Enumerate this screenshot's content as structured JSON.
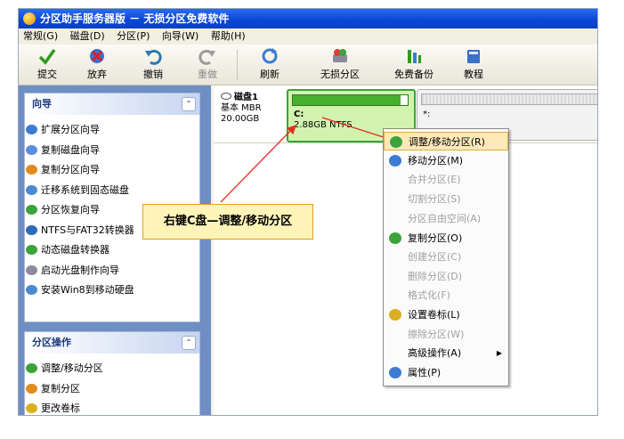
{
  "window": {
    "title": "分区助手服务器版 － 无损分区免费软件"
  },
  "menubar": [
    "常规(G)",
    "磁盘(D)",
    "分区(P)",
    "向导(W)",
    "帮助(H)"
  ],
  "toolbar": {
    "commit": "提交",
    "discard": "放弃",
    "undo": "撤销",
    "redo": "重做",
    "refresh": "刷新",
    "lossless": "无损分区",
    "backup": "免费备份",
    "tutorial": "教程"
  },
  "wizard_panel": {
    "title": "向导",
    "items": [
      "扩展分区向导",
      "复制磁盘向导",
      "复制分区向导",
      "迁移系统到固态磁盘",
      "分区恢复向导",
      "NTFS与FAT32转换器",
      "动态磁盘转换器",
      "启动光盘制作向导",
      "安装Win8到移动硬盘"
    ]
  },
  "partition_panel": {
    "title": "分区操作",
    "items": [
      "调整/移动分区",
      "复制分区",
      "更改卷标"
    ]
  },
  "disk": {
    "name": "磁盘1",
    "type": "基本 MBR",
    "size": "20.00GB",
    "partition_c": {
      "label": "C:",
      "info": "2.88GB NTFS"
    },
    "next_partition": {
      "label": "*:"
    }
  },
  "context_menu": [
    {
      "label": "调整/移动分区(R)",
      "state": "highlight"
    },
    {
      "label": "移动分区(M)",
      "state": "enabled"
    },
    {
      "label": "合并分区(E)",
      "state": "disabled"
    },
    {
      "label": "切割分区(S)",
      "state": "disabled"
    },
    {
      "label": "分区自由空间(A)",
      "state": "disabled"
    },
    {
      "label": "复制分区(O)",
      "state": "enabled"
    },
    {
      "label": "创建分区(C)",
      "state": "disabled"
    },
    {
      "label": "删除分区(D)",
      "state": "disabled"
    },
    {
      "label": "格式化(F)",
      "state": "disabled"
    },
    {
      "label": "设置卷标(L)",
      "state": "enabled"
    },
    {
      "label": "擦除分区(W)",
      "state": "disabled"
    },
    {
      "label": "高级操作(A)",
      "state": "enabled"
    },
    {
      "label": "属性(P)",
      "state": "enabled"
    }
  ],
  "annotation": "右键C盘—调整/移动分区",
  "colors": {
    "titlebar": "#0b48d8",
    "partition_selected": "#d2f3b0",
    "partition_border": "#3aa33a",
    "annotation_fill": "#fff4b8",
    "arrow": "#e03020"
  }
}
